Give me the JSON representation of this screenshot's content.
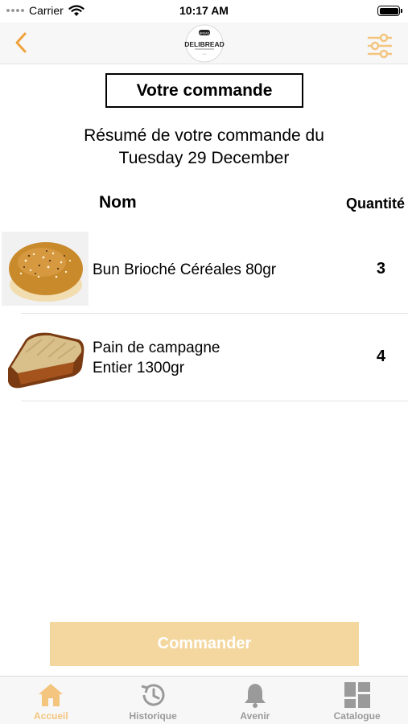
{
  "status_bar": {
    "carrier": "Carrier",
    "time": "10:17 AM"
  },
  "nav": {
    "logo_text": "DELIBREAD"
  },
  "header": {
    "title": "Votre commande",
    "summary_line1": "Résumé de votre commande du",
    "summary_line2": "Tuesday 29 December"
  },
  "table": {
    "col_name": "Nom",
    "col_qty": "Quantité",
    "rows": [
      {
        "name": "Bun Brioché Céréales 80gr",
        "qty": "3"
      },
      {
        "name_line1": "Pain de campagne",
        "name_line2": "Entier 1300gr",
        "qty": "4"
      }
    ]
  },
  "order_button": {
    "label": "Commander"
  },
  "tabs": [
    {
      "label": "Accueil",
      "icon": "home-icon",
      "active": true
    },
    {
      "label": "Historique",
      "icon": "history-icon",
      "active": false
    },
    {
      "label": "Avenir",
      "icon": "bell-icon",
      "active": false
    },
    {
      "label": "Catalogue",
      "icon": "grid-icon",
      "active": false
    }
  ],
  "colors": {
    "accent": "#f0a23b",
    "button": "#f3d79e",
    "tab_active": "#f3c57f",
    "tab_inactive": "#9a9a9a"
  }
}
